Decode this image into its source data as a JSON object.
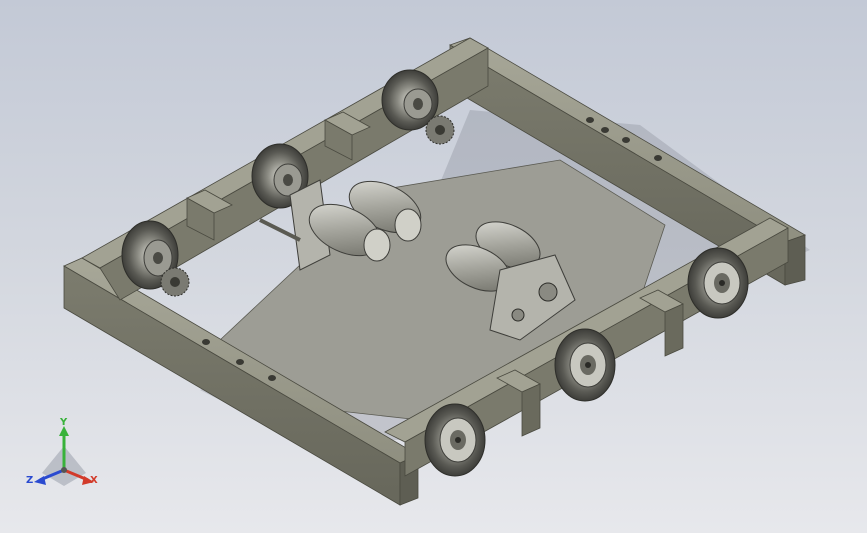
{
  "viewport": {
    "background_top": "#c3c9d6",
    "background_bottom": "#e7e8ec"
  },
  "model": {
    "description_name": "robot-chassis-assembly",
    "frame_color": "#8c8c7c",
    "plate_color": "#9b9b92",
    "wheel_color": "#6f6f68"
  },
  "triad": {
    "y_label": "Y",
    "x_label": "X",
    "z_label": "Z",
    "x_color": "#d23a2a",
    "y_color": "#38b23a",
    "z_color": "#2a4ad0"
  }
}
